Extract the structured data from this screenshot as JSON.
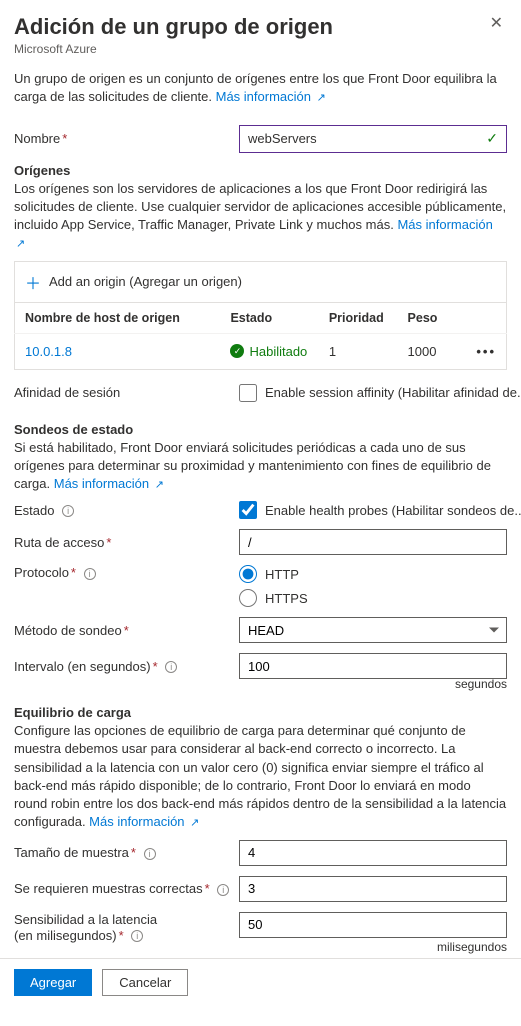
{
  "header": {
    "title": "Adición de un grupo de origen",
    "subtitle": "Microsoft Azure"
  },
  "intro": {
    "text": "Un grupo de origen es un conjunto de orígenes entre los que Front Door equilibra la carga de las solicitudes de cliente. ",
    "link": "Más información"
  },
  "name": {
    "label": "Nombre",
    "value": "webServers"
  },
  "origins": {
    "title": "Orígenes",
    "desc": "Los orígenes son los servidores de aplicaciones a los que Front Door redirigirá las solicitudes de cliente. Use cualquier servidor de aplicaciones accesible públicamente, incluido App Service, Traffic Manager, Private Link y muchos más. ",
    "link": "Más información",
    "add_button": "Add an origin (Agregar un origen)",
    "columns": {
      "host": "Nombre de host de origen",
      "status": "Estado",
      "priority": "Prioridad",
      "weight": "Peso"
    },
    "rows": [
      {
        "host": "10.0.1.8",
        "status": "Habilitado",
        "priority": "1",
        "weight": "1000"
      }
    ]
  },
  "session_affinity": {
    "label": "Afinidad de sesión",
    "checkbox_label": "Enable session affinity (Habilitar afinidad de...",
    "checked": false
  },
  "health_probes": {
    "title": "Sondeos de estado",
    "desc": "Si está habilitado, Front Door enviará solicitudes periódicas a cada uno de sus orígenes para determinar su proximidad y mantenimiento con fines de equilibrio de carga. ",
    "link": "Más información",
    "status_label": "Estado",
    "status_checkbox_label": "Enable health probes (Habilitar sondeos de...",
    "status_checked": true,
    "path_label": "Ruta de acceso",
    "path_value": "/",
    "protocol_label": "Protocolo",
    "protocol_options": {
      "http": "HTTP",
      "https": "HTTPS"
    },
    "protocol_selected": "http",
    "method_label": "Método de sondeo",
    "method_value": "HEAD",
    "interval_label": "Intervalo (en segundos)",
    "interval_value": "100",
    "interval_unit": "segundos"
  },
  "load_balancing": {
    "title": "Equilibrio de carga",
    "desc": "Configure las opciones de equilibrio de carga para determinar qué conjunto de muestra debemos usar para considerar al back-end correcto o incorrecto. La sensibilidad a la latencia con un valor cero (0) significa enviar siempre el tráfico al back-end más rápido disponible; de lo contrario, Front Door lo enviará en modo round robin entre los dos back-end más rápidos dentro de la sensibilidad a la latencia configurada. ",
    "link": "Más información",
    "sample_size_label": "Tamaño de muestra",
    "sample_size_value": "4",
    "successful_samples_label": "Se requieren muestras correctas",
    "successful_samples_value": "3",
    "latency_label_line1": "Sensibilidad a la latencia",
    "latency_label_line2": "(en milisegundos)",
    "latency_value": "50",
    "latency_unit": "milisegundos"
  },
  "footer": {
    "primary": "Agregar",
    "secondary": "Cancelar"
  }
}
